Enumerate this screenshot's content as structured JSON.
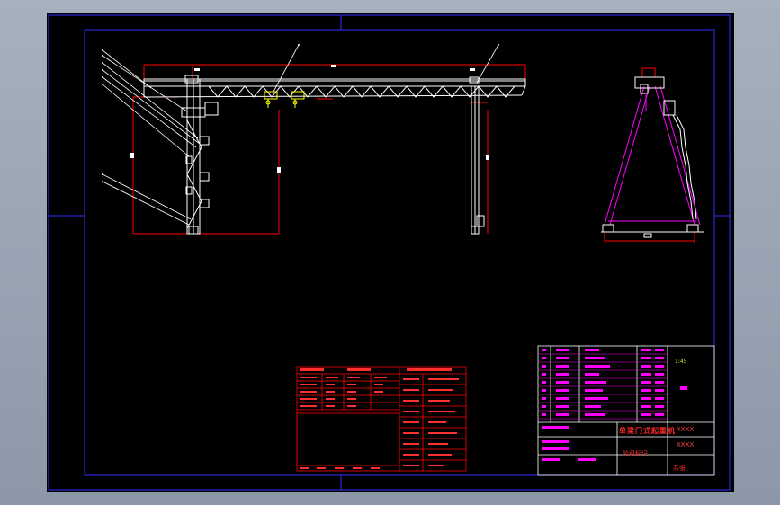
{
  "drawing": {
    "title_block": {
      "name": "单梁门式起重机",
      "code_1": "XXXX",
      "code_2": "XXXX",
      "scale": "1:45",
      "sheet": "共张",
      "stage": "阶段标记"
    }
  },
  "colors": {
    "background": "#000000",
    "frame": "#0000ff",
    "geometry": "#ffffff",
    "dimensions": "#ff0000",
    "hoist": "#ffff00",
    "table_text": "#ff00ff"
  },
  "icons": {
    "leader_marker": "dot-marker"
  }
}
